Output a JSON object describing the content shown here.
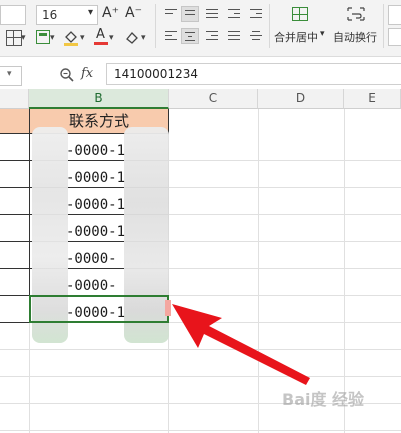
{
  "ribbon": {
    "font_size": "16",
    "increase_font_icon": "A⁺",
    "decrease_font_icon": "A⁻",
    "merge_center_label": "合并居中",
    "wrap_text_label": "自动换行",
    "merge_caret": "▾"
  },
  "formula_bar": {
    "zoom_icon": "zoom-icon",
    "fx_label": "fx",
    "formula_value": "14100001234"
  },
  "grid": {
    "columns": [
      "B",
      "C",
      "D",
      "E"
    ],
    "selected_column": "B",
    "header_cell": "联系方式",
    "header_fill": "#f8cbad",
    "selection_color": "#2e7d32",
    "rows": [
      "-0000-1",
      "-0000-1",
      "-0000-1",
      "-0000-1",
      "-0000-",
      "-0000-",
      "-0000-1"
    ]
  },
  "annotation": {
    "arrow_color": "#e8141b",
    "watermark": "Bai度 经验"
  }
}
